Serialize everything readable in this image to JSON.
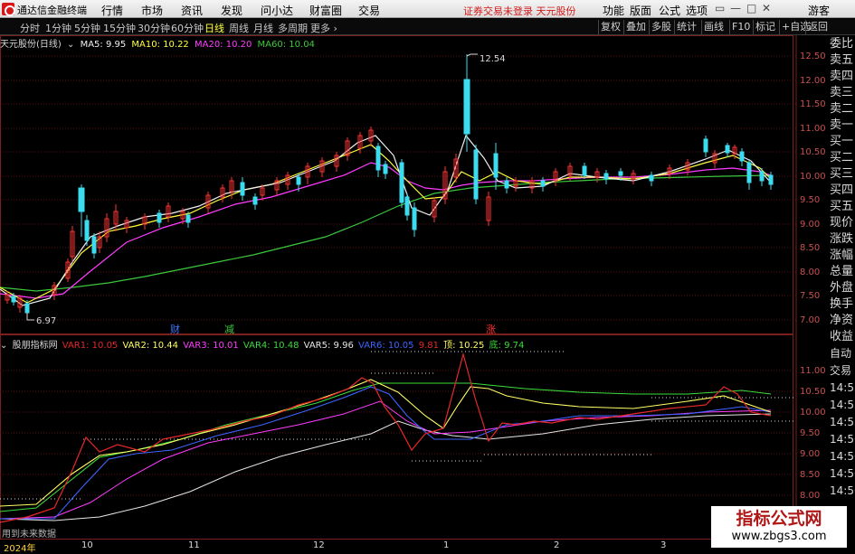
{
  "menubar": {
    "app_title": "通达信金融终端",
    "items": [
      "行情",
      "市场",
      "资讯",
      "发现",
      "问小达",
      "财富圈",
      "交易"
    ],
    "notice": "证券交易未登录",
    "stock_name": "天元股份",
    "right_items": [
      "功能",
      "版面",
      "公式",
      "选项"
    ],
    "guest": "游客"
  },
  "timeframes": [
    "分时",
    "1分钟",
    "5分钟",
    "15分钟",
    "30分钟",
    "60分钟",
    "日线",
    "周线",
    "月线",
    "多周期",
    "更多"
  ],
  "active_timeframe": "日线",
  "toolbar_right": [
    "复权",
    "叠加",
    "多股",
    "统计",
    "画线",
    "F10",
    "标记",
    "+自选",
    "返回"
  ],
  "ma_line": {
    "title": "天元股份(日线)",
    "ma5": "MA5: 9.95",
    "ma10": "MA10: 10.22",
    "ma20": "MA20: 10.20",
    "ma60": "MA60: 10.04"
  },
  "indicator_line": {
    "name": "股朋指标网",
    "var1": "VAR1: 10.05",
    "var2": "VAR2: 10.44",
    "var3": "VAR3: 10.01",
    "var4": "VAR4: 10.48",
    "var5": "VAR5: 9.96",
    "var6": "VAR6: 10.05",
    "var7": "9.81",
    "top": "顶: 10.25",
    "bottom": "底: 9.74"
  },
  "price_axis": [
    "12.50",
    "12.00",
    "11.50",
    "11.00",
    "10.50",
    "10.00",
    "9.50",
    "9.00",
    "8.50",
    "8.00",
    "7.50",
    "7.00"
  ],
  "indicator_axis": [
    "11.00",
    "10.50",
    "10.00",
    "9.50",
    "9.00",
    "8.50",
    "8.00"
  ],
  "labels": {
    "high": "12.54",
    "low": "6.97",
    "cai": "财",
    "jian": "减",
    "zhang": "涨"
  },
  "right_panel": [
    "委比",
    "卖五",
    "卖四",
    "卖三",
    "卖二",
    "卖一",
    "买一",
    "买二",
    "买三",
    "买四",
    "买五",
    "现价",
    "涨跌",
    "涨幅",
    "总量",
    "外盘",
    "换手",
    "净资",
    "收益"
  ],
  "right_panel_lower": [
    "自动",
    "交易",
    "14:55",
    "14:55",
    "14:55",
    "14:56",
    "14:56",
    "14:56",
    "14:56",
    "14:56",
    "14:56"
  ],
  "future_note": "用到未来数据",
  "time_axis": [
    "2024年",
    "10",
    "11",
    "12",
    "1",
    "2",
    "3"
  ],
  "watermark": {
    "title": "指标公式网",
    "url": "www.zbgs3.com"
  },
  "colors": {
    "up": "#ff3232",
    "down": "#3cdcf0",
    "ma5": "#f0f0f0",
    "ma10": "#ffff3c",
    "ma20": "#ff3cff",
    "ma60": "#3cc83c"
  }
}
